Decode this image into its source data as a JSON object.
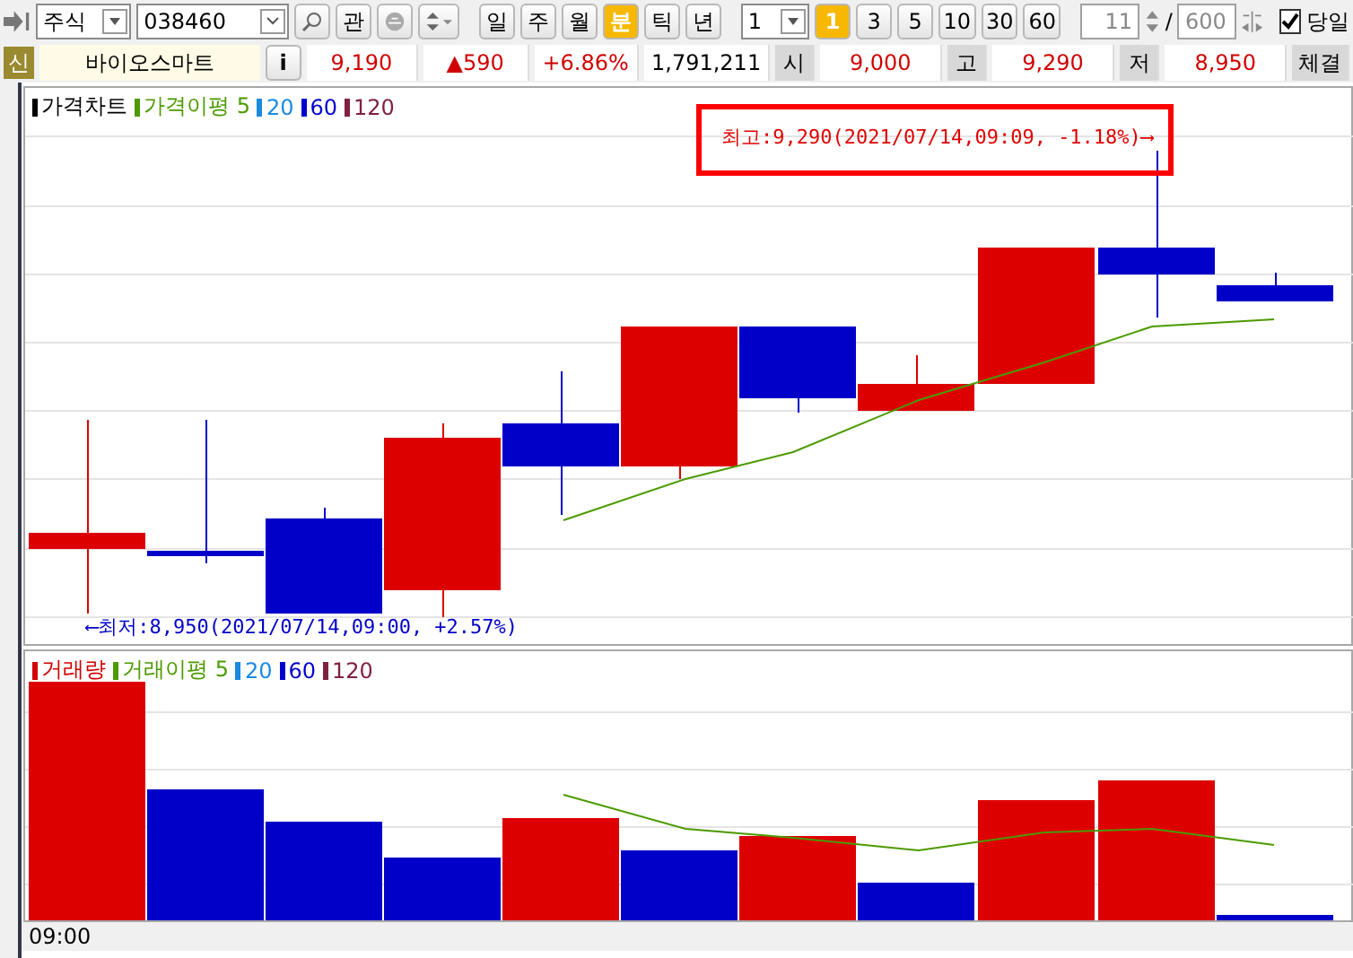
{
  "toolbar": {
    "market": "주식",
    "code": "038460",
    "watch_button": "관",
    "periods": [
      {
        "label": "일",
        "selected": false
      },
      {
        "label": "주",
        "selected": false
      },
      {
        "label": "월",
        "selected": false
      },
      {
        "label": "분",
        "selected": true
      },
      {
        "label": "틱",
        "selected": false
      },
      {
        "label": "년",
        "selected": false
      }
    ],
    "interval_select": "1",
    "intervals": [
      {
        "label": "1",
        "selected": true
      },
      {
        "label": "3",
        "selected": false
      },
      {
        "label": "5",
        "selected": false
      },
      {
        "label": "10",
        "selected": false
      },
      {
        "label": "30",
        "selected": false
      },
      {
        "label": "60",
        "selected": false
      }
    ],
    "count": "11",
    "separator": "/",
    "max_count": "600",
    "today": {
      "label": "당일",
      "checked": true
    }
  },
  "quote": {
    "badge": "신",
    "name": "바이오스마트",
    "info_button": "i",
    "price": "9,190",
    "change": "▲590",
    "rate": "+6.86%",
    "volume": "1,791,211",
    "fields": [
      {
        "label": "시",
        "value": "9,000"
      },
      {
        "label": "고",
        "value": "9,290"
      },
      {
        "label": "저",
        "value": "8,950"
      }
    ],
    "trailing_tab": "체결"
  },
  "price_pane": {
    "legend": [
      {
        "label": "가격차트",
        "color": "#000000"
      },
      {
        "label": "가격이평 5",
        "color": "#4c9a00"
      },
      {
        "label": "20",
        "color": "#1a8ae0"
      },
      {
        "label": "60",
        "color": "#0000d0"
      },
      {
        "label": "120",
        "color": "#802040"
      }
    ],
    "high_note": "최고:9,290(2021/07/14,09:09, -1.18%)⟶",
    "low_note": "⟵최저:8,950(2021/07/14,09:00, +2.57%)"
  },
  "volume_pane": {
    "legend": [
      {
        "label": "거래량",
        "color": "#d00000"
      },
      {
        "label": "거래이평 5",
        "color": "#4c9a00"
      },
      {
        "label": "20",
        "color": "#1a8ae0"
      },
      {
        "label": "60",
        "color": "#0000d0"
      },
      {
        "label": "120",
        "color": "#802040"
      }
    ]
  },
  "time_axis": "09:00"
}
